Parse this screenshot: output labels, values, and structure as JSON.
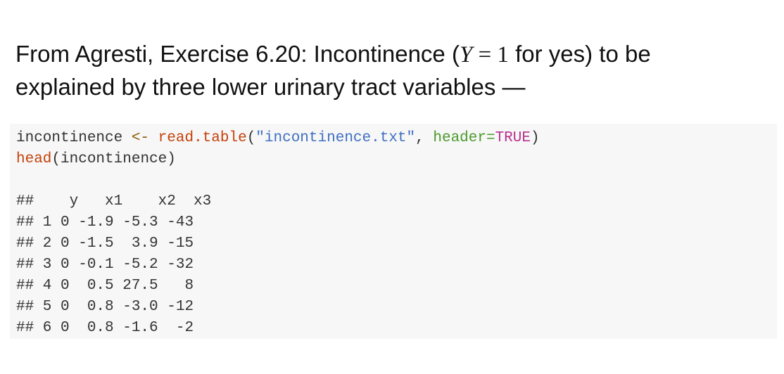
{
  "intro": {
    "line1_pre": "From Agresti, Exercise 6.20: Incontinence (",
    "math_var": "Y",
    "math_eq": " = 1",
    "line1_post": " for yes) to be",
    "line2": "explained by three lower urinary tract variables —"
  },
  "code": {
    "line1": {
      "var": "incontinence ",
      "assign": "<-",
      "space": " ",
      "func": "read.table",
      "paren_open": "(",
      "string": "\"incontinence.txt\"",
      "comma": ", ",
      "arg": "header=",
      "const": "TRUE",
      "paren_close": ")"
    },
    "line2": {
      "func": "head",
      "rest": "(incontinence)"
    }
  },
  "output": {
    "lines": [
      "##    y   x1    x2  x3",
      "## 1 0 -1.9 -5.3 -43",
      "## 2 0 -1.5  3.9 -15",
      "## 3 0 -0.1 -5.2 -32",
      "## 4 0  0.5 27.5   8",
      "## 5 0  0.8 -3.0 -12",
      "## 6 0  0.8 -1.6  -2"
    ]
  }
}
